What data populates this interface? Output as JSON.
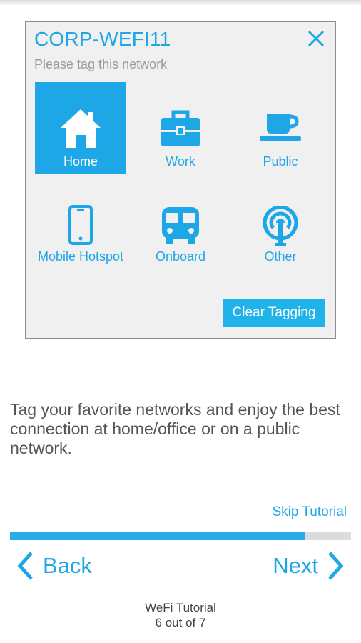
{
  "dialog": {
    "title": "CORP-WEFI11",
    "subtitle": "Please tag this network",
    "close_icon": "close-icon",
    "tags": [
      {
        "label": "Home",
        "icon": "home-icon",
        "selected": true
      },
      {
        "label": "Work",
        "icon": "briefcase-icon",
        "selected": false
      },
      {
        "label": "Public",
        "icon": "coffee-cup-icon",
        "selected": false
      },
      {
        "label": "Mobile Hotspot",
        "icon": "smartphone-icon",
        "selected": false
      },
      {
        "label": "Onboard",
        "icon": "bus-icon",
        "selected": false
      },
      {
        "label": "Other",
        "icon": "antenna-icon",
        "selected": false
      }
    ],
    "clear_button": "Clear Tagging"
  },
  "description": "Tag your favorite networks and enjoy the best connection at home/office or on a public network.",
  "skip": "Skip Tutorial",
  "progress": {
    "current": 6,
    "total": 7
  },
  "nav": {
    "back": "Back",
    "next": "Next"
  },
  "footer": {
    "title": "WeFi Tutorial",
    "count": "6 out of 7"
  },
  "colors": {
    "accent": "#1ea7e6",
    "progress_track": "#dcdcdc"
  }
}
